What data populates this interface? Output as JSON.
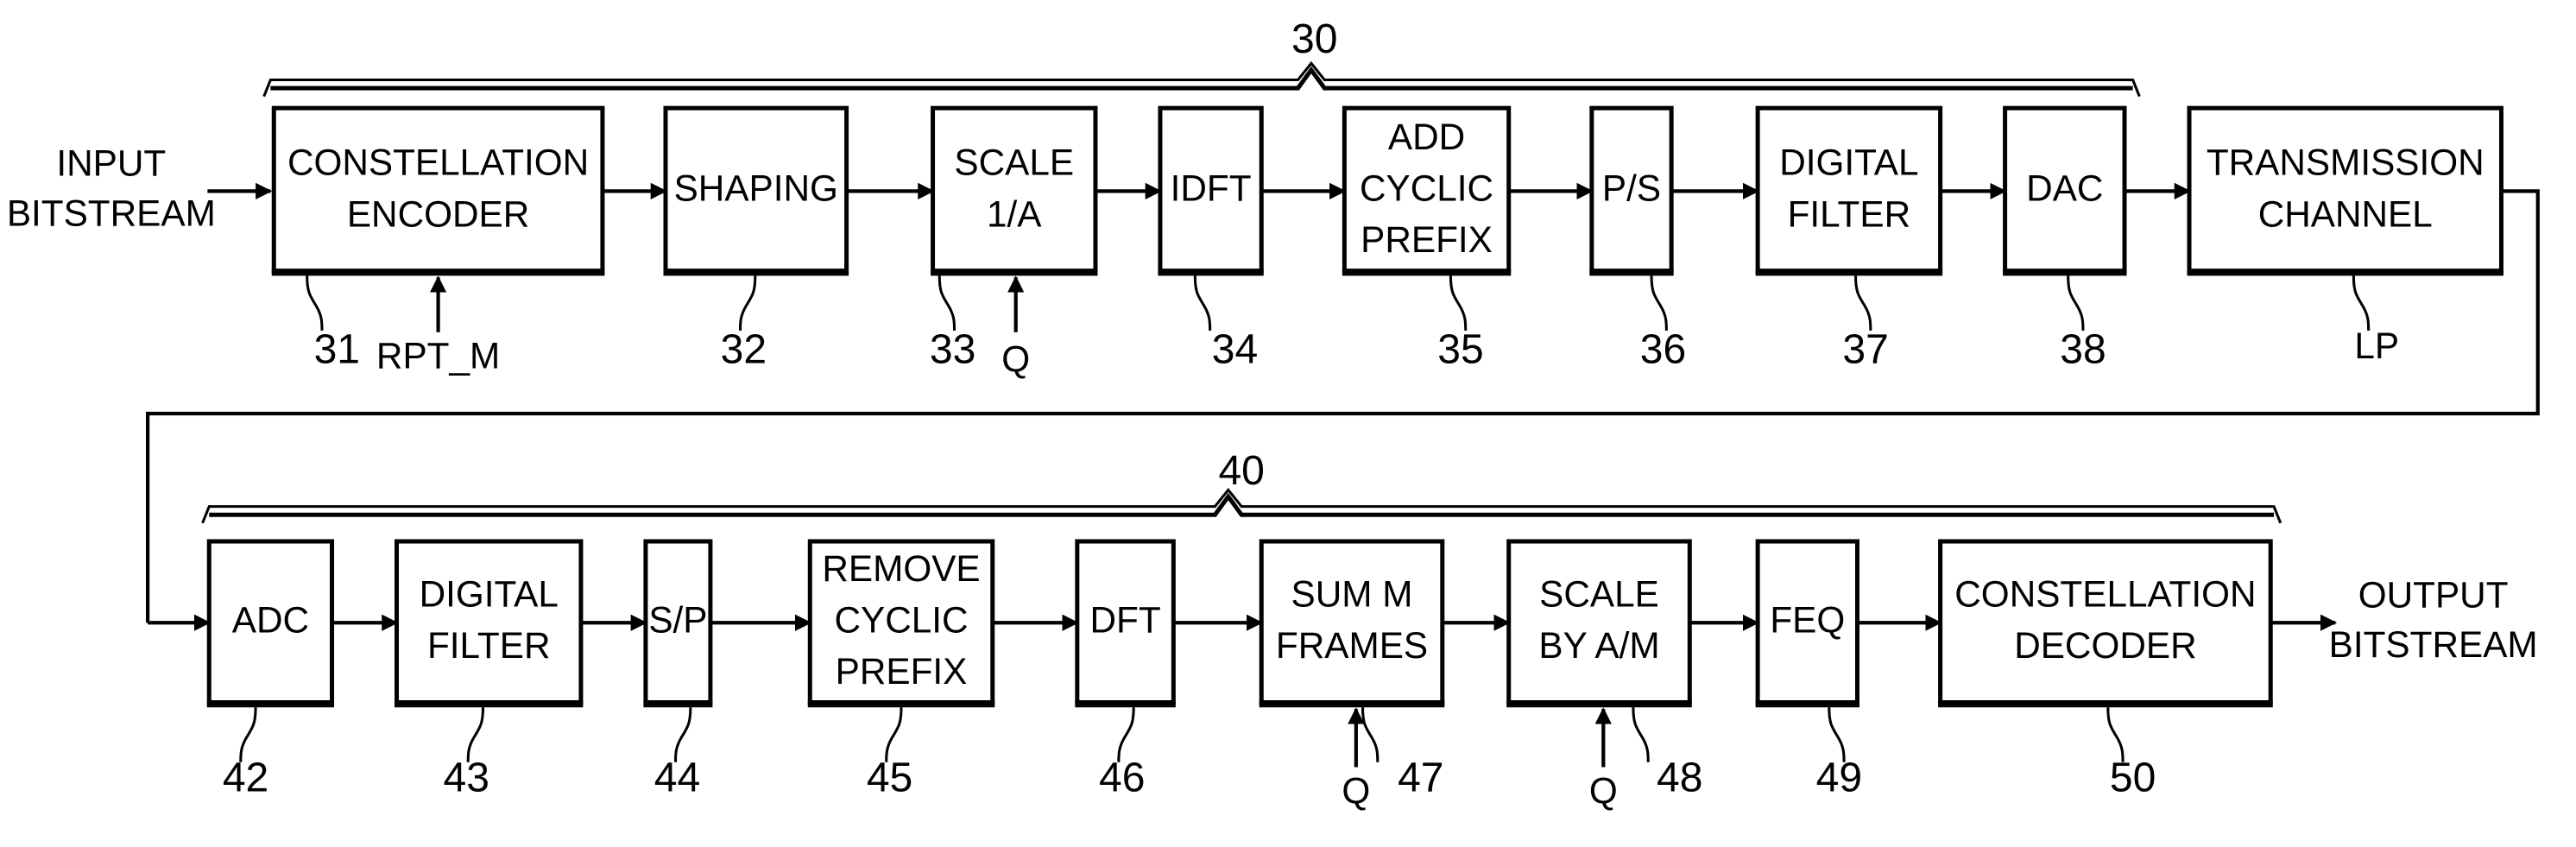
{
  "diagram": {
    "transmitter": {
      "ref": "30",
      "input_label": [
        "INPUT",
        "BITSTREAM"
      ],
      "blocks": [
        {
          "id": "constellation-encoder",
          "lines": [
            "CONSTELLATION",
            "ENCODER"
          ],
          "ref": "31",
          "control": "RPT_M"
        },
        {
          "id": "shaping",
          "lines": [
            "SHAPING"
          ],
          "ref": "32"
        },
        {
          "id": "scale-1-a",
          "lines": [
            "SCALE",
            "1/A"
          ],
          "ref": "33",
          "control": "Q"
        },
        {
          "id": "idft",
          "lines": [
            "IDFT"
          ],
          "ref": "34"
        },
        {
          "id": "add-cyclic-prefix",
          "lines": [
            "ADD",
            "CYCLIC",
            "PREFIX"
          ],
          "ref": "35"
        },
        {
          "id": "p-s",
          "lines": [
            "P/S"
          ],
          "ref": "36"
        },
        {
          "id": "digital-filter-tx",
          "lines": [
            "DIGITAL",
            "FILTER"
          ],
          "ref": "37"
        },
        {
          "id": "dac",
          "lines": [
            "DAC"
          ],
          "ref": "38"
        }
      ]
    },
    "channel": {
      "id": "transmission-channel",
      "lines": [
        "TRANSMISSION",
        "CHANNEL"
      ],
      "ref": "LP"
    },
    "receiver": {
      "ref": "40",
      "output_label": [
        "OUTPUT",
        "BITSTREAM"
      ],
      "blocks": [
        {
          "id": "adc",
          "lines": [
            "ADC"
          ],
          "ref": "42"
        },
        {
          "id": "digital-filter-rx",
          "lines": [
            "DIGITAL",
            "FILTER"
          ],
          "ref": "43"
        },
        {
          "id": "s-p",
          "lines": [
            "S/P"
          ],
          "ref": "44"
        },
        {
          "id": "remove-cyclic-prefix",
          "lines": [
            "REMOVE",
            "CYCLIC",
            "PREFIX"
          ],
          "ref": "45"
        },
        {
          "id": "dft",
          "lines": [
            "DFT"
          ],
          "ref": "46"
        },
        {
          "id": "sum-m-frames",
          "lines": [
            "SUM M",
            "FRAMES"
          ],
          "ref": "47",
          "control": "Q"
        },
        {
          "id": "scale-by-a-m",
          "lines": [
            "SCALE",
            "BY A/M"
          ],
          "ref": "48",
          "control": "Q"
        },
        {
          "id": "feq",
          "lines": [
            "FEQ"
          ],
          "ref": "49"
        },
        {
          "id": "constellation-decoder",
          "lines": [
            "CONSTELLATION",
            "DECODER"
          ],
          "ref": "50"
        }
      ]
    }
  }
}
